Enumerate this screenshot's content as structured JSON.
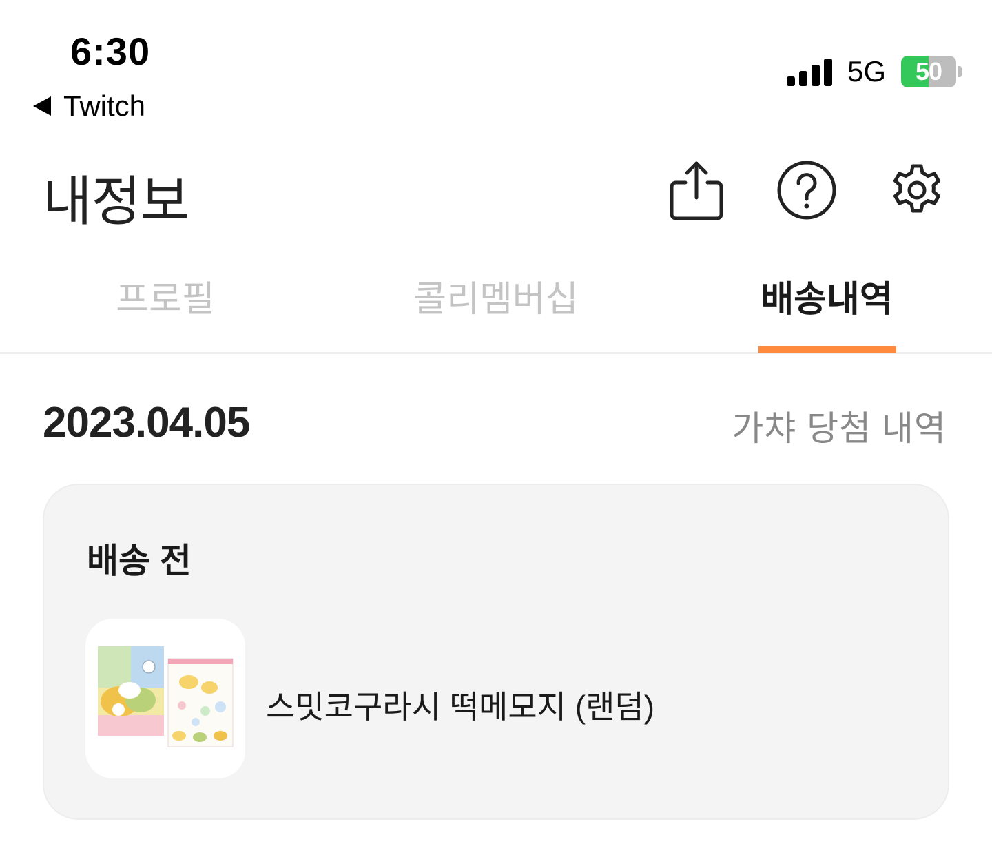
{
  "status_bar": {
    "time": "6:30",
    "back_app": "Twitch",
    "network": "5G",
    "battery_percent": "50",
    "battery_level": 0.5
  },
  "header": {
    "title": "내정보",
    "icons": [
      "share-icon",
      "help-icon",
      "settings-icon"
    ]
  },
  "tabs": [
    {
      "label": "프로필",
      "active": false
    },
    {
      "label": "콜리멤버십",
      "active": false
    },
    {
      "label": "배송내역",
      "active": true
    }
  ],
  "colors": {
    "accent": "#ff8a3d",
    "battery_green": "#34c759",
    "card_bg": "#f4f4f4"
  },
  "section": {
    "date": "2023.04.05",
    "link_label": "가챠 당첨 내역"
  },
  "delivery_card": {
    "status": "배송 전",
    "item": {
      "name": "스밋코구라시 떡메모지 (랜덤)"
    }
  }
}
